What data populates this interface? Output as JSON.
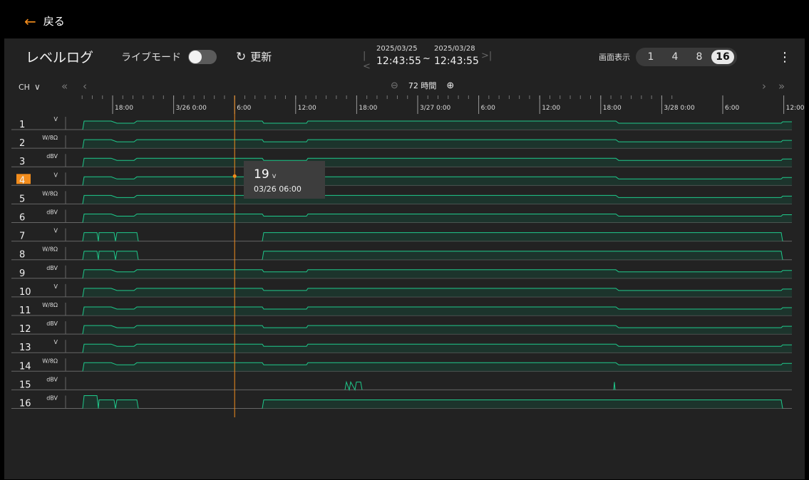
{
  "header": {
    "back_label": "戻る",
    "title": "レベルログ",
    "live_mode_label": "ライブモード",
    "refresh_label": "更新",
    "live_mode_on": false
  },
  "range": {
    "start_date": "2025/03/25",
    "start_time": "12:43:55",
    "separator": "~",
    "end_date": "2025/03/28",
    "end_time": "12:43:55"
  },
  "display": {
    "label": "画面表示",
    "options": [
      "1",
      "4",
      "8",
      "16"
    ],
    "selected": "16"
  },
  "toolbar": {
    "ch_label": "CH",
    "zoom_label": "72 時間"
  },
  "colors": {
    "accent": "#f28c1c",
    "trace": "#1fc98b",
    "fill": "#1b3a30",
    "bg": "#222222"
  },
  "icons": {
    "back": "arrow-left-icon",
    "refresh": "refresh-icon",
    "more": "more-vert-icon",
    "zoom_out": "zoom-out-icon",
    "zoom_in": "zoom-in-icon"
  },
  "time_axis": {
    "labels": [
      "18:00",
      "3/26 0:00",
      "6:00",
      "12:00",
      "18:00",
      "3/27 0:00",
      "6:00",
      "12:00",
      "18:00",
      "3/28 0:00",
      "6:00",
      "12:00"
    ]
  },
  "channels": [
    {
      "num": "1",
      "unit": "V"
    },
    {
      "num": "2",
      "unit": "W/8Ω"
    },
    {
      "num": "3",
      "unit": "dBV"
    },
    {
      "num": "4",
      "unit": "V",
      "selected": true
    },
    {
      "num": "5",
      "unit": "W/8Ω"
    },
    {
      "num": "6",
      "unit": "dBV"
    },
    {
      "num": "7",
      "unit": "V"
    },
    {
      "num": "8",
      "unit": "W/8Ω"
    },
    {
      "num": "9",
      "unit": "dBV"
    },
    {
      "num": "10",
      "unit": "V"
    },
    {
      "num": "11",
      "unit": "W/8Ω"
    },
    {
      "num": "12",
      "unit": "dBV"
    },
    {
      "num": "13",
      "unit": "V"
    },
    {
      "num": "14",
      "unit": "W/8Ω"
    },
    {
      "num": "15",
      "unit": "dBV"
    },
    {
      "num": "16",
      "unit": "dBV"
    }
  ],
  "cursor": {
    "value": "19",
    "unit": "v",
    "datetime": "03/26 06:00",
    "time": "3/26 6:00"
  }
}
